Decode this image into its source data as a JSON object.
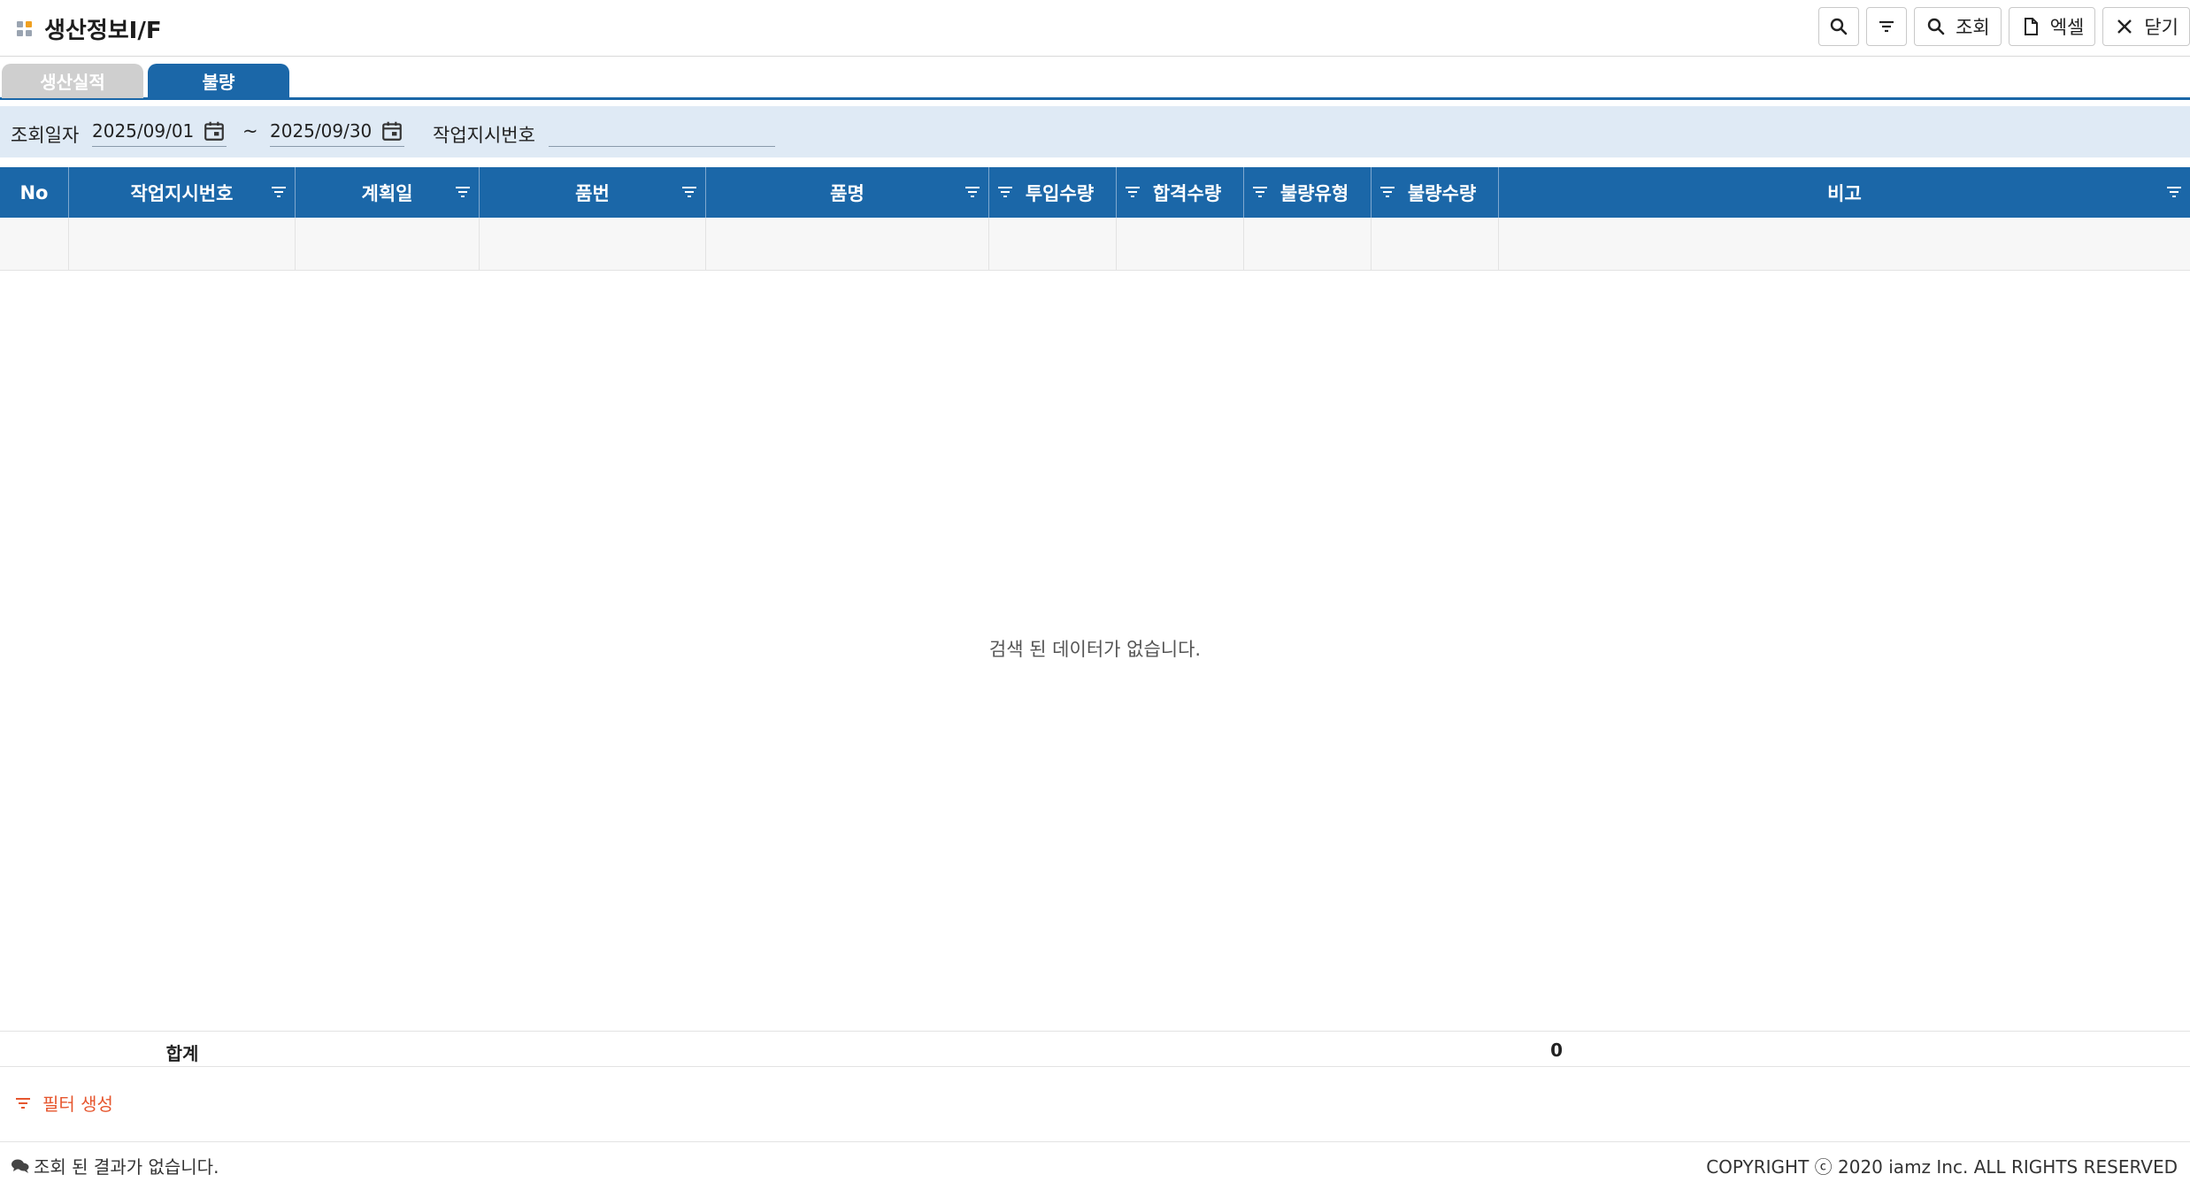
{
  "header": {
    "title": "생산정보I/F",
    "toolbar": {
      "search_label": "조회",
      "excel_label": "엑셀",
      "close_label": "닫기"
    }
  },
  "tabs": [
    {
      "label": "생산실적",
      "active": false
    },
    {
      "label": "불량",
      "active": true
    }
  ],
  "search": {
    "date_label": "조회일자",
    "date_from": "2025/09/01",
    "date_to": "2025/09/30",
    "range_sep": "~",
    "work_order_label": "작업지시번호",
    "work_order_value": ""
  },
  "grid": {
    "columns": [
      {
        "label": "No"
      },
      {
        "label": "작업지시번호"
      },
      {
        "label": "계획일"
      },
      {
        "label": "품번"
      },
      {
        "label": "품명"
      },
      {
        "label": "투입수량"
      },
      {
        "label": "합격수량"
      },
      {
        "label": "불량유형"
      },
      {
        "label": "불량수량"
      },
      {
        "label": "비고"
      }
    ],
    "empty_message": "검색 된 데이터가 없습니다.",
    "summary_label": "합계",
    "summary_value": "0"
  },
  "filter_create_label": "필터 생성",
  "footer": {
    "status": "조회 된 결과가 없습니다.",
    "copyright": "COPYRIGHT ⓒ 2020 iamz Inc. ALL RIGHTS RESERVED"
  },
  "colors": {
    "primary": "#1b67a8",
    "search_bg": "#dfeaf5",
    "accent": "#e6562e"
  }
}
